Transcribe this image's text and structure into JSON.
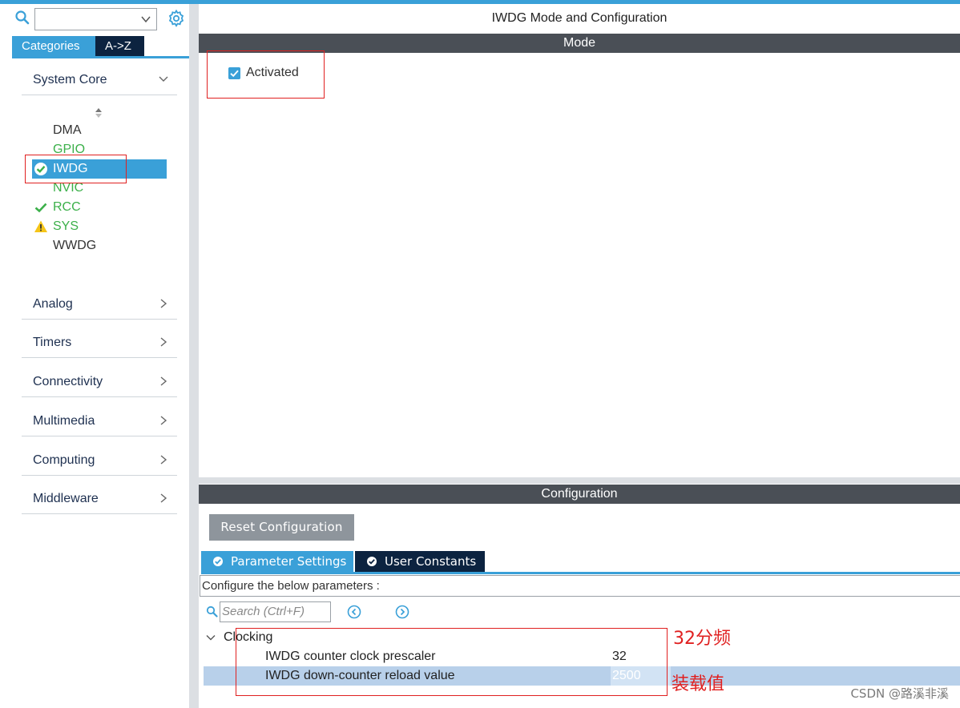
{
  "colors": {
    "accent": "#3aa0d8",
    "dark_tab": "#0c2340",
    "section_header": "#4a4f56",
    "enabled_green": "#3cb04a",
    "warning_yellow": "#f5c518",
    "annotation_red": "#e02020"
  },
  "left_panel": {
    "search": {
      "value": ""
    },
    "tabs": {
      "categories": "Categories",
      "az": "A->Z"
    },
    "categories": [
      {
        "label": "System Core",
        "expanded": true
      },
      {
        "label": "Analog"
      },
      {
        "label": "Timers"
      },
      {
        "label": "Connectivity"
      },
      {
        "label": "Multimedia"
      },
      {
        "label": "Computing"
      },
      {
        "label": "Middleware"
      }
    ],
    "system_core_items": [
      {
        "label": "DMA",
        "status": "none"
      },
      {
        "label": "GPIO",
        "status": "enabled"
      },
      {
        "label": "IWDG",
        "status": "selected-ok"
      },
      {
        "label": "NVIC",
        "status": "enabled"
      },
      {
        "label": "RCC",
        "status": "check"
      },
      {
        "label": "SYS",
        "status": "warning"
      },
      {
        "label": "WWDG",
        "status": "none"
      }
    ]
  },
  "main": {
    "title": "IWDG Mode and Configuration",
    "mode_header": "Mode",
    "activated_label": "Activated",
    "activated_checked": true,
    "config_header": "Configuration",
    "reset_button": "Reset Configuration",
    "tabs": {
      "parameter_settings": "Parameter Settings",
      "user_constants": "User Constants"
    },
    "configure_text": "Configure the below parameters :",
    "search_placeholder": "Search (Ctrl+F)",
    "group_label": "Clocking",
    "params": [
      {
        "name": "IWDG counter clock prescaler",
        "value": "32"
      },
      {
        "name": "IWDG down-counter reload value",
        "value": "2500"
      }
    ]
  },
  "annotations": {
    "prescaler_note": "32分频",
    "reload_note": "装载值"
  },
  "watermark": "CSDN @路溪非溪"
}
